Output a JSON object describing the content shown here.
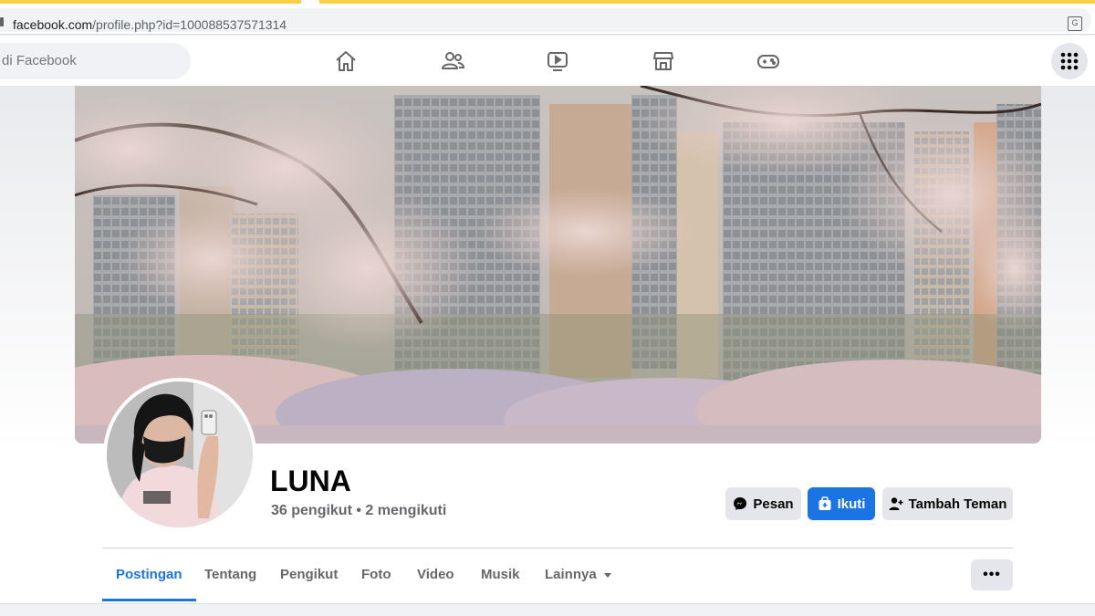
{
  "browser": {
    "url_host": "facebook.com",
    "url_path": "/profile.php?id=100088537571314"
  },
  "nav": {
    "search_placeholder": "di Facebook",
    "icons": [
      "home-icon",
      "friends-icon",
      "watch-icon",
      "marketplace-icon",
      "gaming-icon",
      "menu-grid-icon"
    ]
  },
  "profile": {
    "name": "LUNA",
    "followers": "36 pengikut",
    "separator": "•",
    "following": "2 mengikuti"
  },
  "actions": {
    "message_label": "Pesan",
    "follow_label": "Ikuti",
    "add_friend_label": "Tambah Teman",
    "more_label": "•••"
  },
  "tabs": [
    {
      "label": "Postingan",
      "active": true
    },
    {
      "label": "Tentang"
    },
    {
      "label": "Pengikut"
    },
    {
      "label": "Foto"
    },
    {
      "label": "Video"
    },
    {
      "label": "Musik"
    },
    {
      "label": "Lainnya"
    }
  ],
  "colors": {
    "accent": "#1b74e4",
    "button_grey": "#e4e6eb",
    "text_secondary": "#65676b"
  }
}
